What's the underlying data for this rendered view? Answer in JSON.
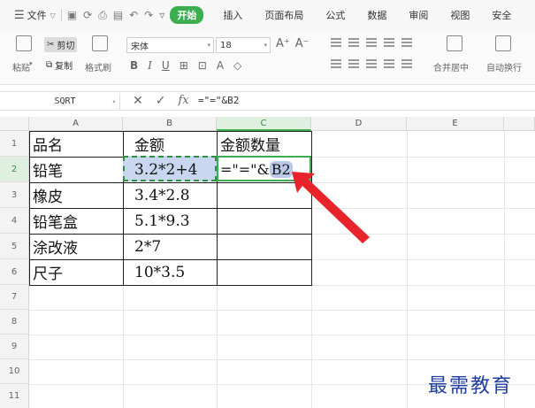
{
  "menu": {
    "file_label": "文件"
  },
  "tabs": [
    {
      "label": "开始",
      "active": true
    },
    {
      "label": "插入"
    },
    {
      "label": "页面布局"
    },
    {
      "label": "公式"
    },
    {
      "label": "数据"
    },
    {
      "label": "审阅"
    },
    {
      "label": "视图"
    },
    {
      "label": "安全"
    }
  ],
  "ribbon": {
    "cut_label": "剪切",
    "paste_label": "粘贴",
    "copy_label": "复制",
    "format_painter_label": "格式刷",
    "font_name": "宋体",
    "font_size": "18",
    "merge_label": "合并居中",
    "wrap_label": "自动换行"
  },
  "formula_bar": {
    "name_box": "SQRT",
    "cancel_glyph": "✕",
    "confirm_glyph": "✓",
    "fx_glyph": "fx",
    "formula": "=\"=\"&B2"
  },
  "sheet": {
    "columns": [
      "A",
      "B",
      "C",
      "D",
      "E"
    ],
    "rows": [
      "1",
      "2",
      "3",
      "4",
      "5",
      "6",
      "7",
      "8",
      "9",
      "10",
      "11"
    ],
    "cells": {
      "A1": "品名",
      "B1": "金额",
      "C1": "金额数量",
      "A2": "铅笔",
      "B2": "3.2*2+4",
      "C2_text": "=\"=\"&",
      "C2_ref": "B2",
      "A3": "橡皮",
      "B3": "3.4*2.8",
      "A4": "铅笔盒",
      "B4": "5.1*9.3",
      "A5": "涂改液",
      "B5": "2*7",
      "A6": "尺子",
      "B6": "10*3.5"
    }
  },
  "watermark": "最需教育",
  "colors": {
    "accent": "#3dae4f",
    "arrow": "#e8232b",
    "watermark": "#1f3e9e"
  }
}
